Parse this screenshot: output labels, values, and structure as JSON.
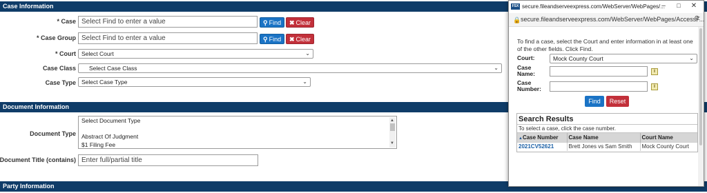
{
  "sections": {
    "case_info": "Case Information",
    "document_info": "Document Information",
    "party_info": "Party Information"
  },
  "form": {
    "case_label": "* Case",
    "case_placeholder": "Select Find to enter a value",
    "case_group_label": "* Case Group",
    "case_group_placeholder": "Select Find to enter a value",
    "court_label": "* Court",
    "court_value": "Select Court",
    "case_class_label": "Case Class",
    "case_class_value": "Select Case Class",
    "case_type_label": "Case Type",
    "case_type_value": "Select Case Type",
    "find_label": "Find",
    "clear_label": "Clear",
    "document_type_label": "Document Type",
    "document_type_options": [
      "Select Document Type",
      "",
      "Abstract Of Judgment",
      "$1 Filing Fee"
    ],
    "document_title_label": "Document Title (contains)",
    "document_title_placeholder": "Enter full/partial title"
  },
  "popup": {
    "window_title": "secure.fileandserveexpress.com/WebServer/WebPages/...",
    "favicon_text": "FSX",
    "url": "secure.fileandserveexpress.com/WebServer/WebPages/AccessF...",
    "instructions": "To find a case, select the Court and enter information in at least one of the other fields. Click Find.",
    "court_label": "Court:",
    "court_value": "Mock County Court",
    "case_name_label_1": "Case",
    "case_name_label_2": "Name:",
    "case_number_label_1": "Case",
    "case_number_label_2": "Number:",
    "find_label": "Find",
    "reset_label": "Reset",
    "results_title": "Search Results",
    "results_hint": "To select a case, click the case number.",
    "columns": [
      "Case Number",
      "Case Name",
      "Court Name"
    ],
    "rows": [
      [
        "2021CV52621",
        "Brett Jones vs Sam Smith",
        "Mock County Court"
      ]
    ]
  },
  "colors": {
    "section_bar": "#0f3c68",
    "find_button": "#1a73c5",
    "clear_button": "#c2303a",
    "link": "#1a5fa6"
  },
  "icons": {
    "find": "magnifier-icon",
    "clear": "x-icon",
    "minimize": "minimize-icon",
    "maximize": "maximize-icon",
    "close": "close-icon",
    "lock": "lock-icon",
    "zoom": "zoom-icon",
    "info": "info-icon",
    "sort": "sort-asc-icon"
  }
}
